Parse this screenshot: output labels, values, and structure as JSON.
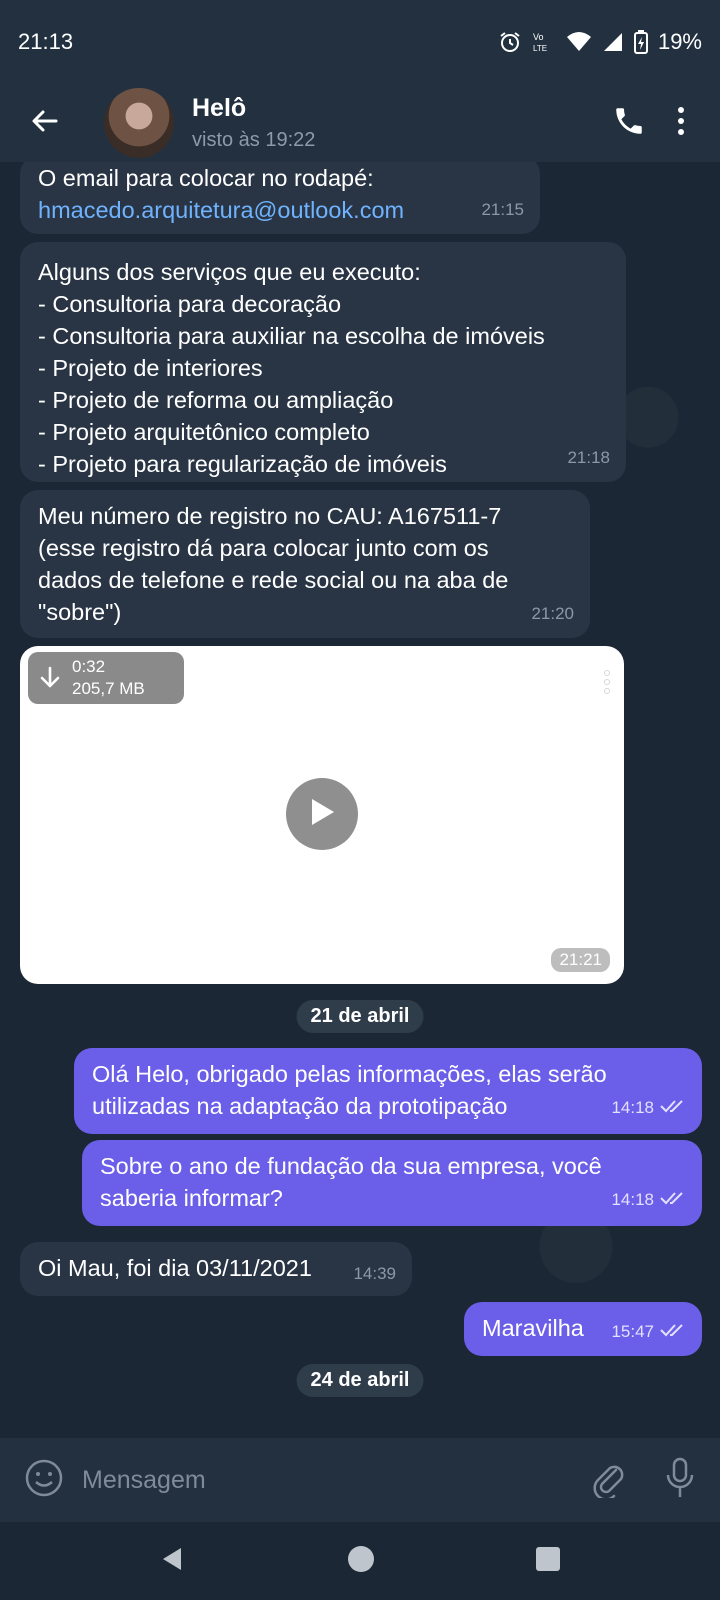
{
  "status_bar": {
    "time": "21:13",
    "battery": "19%",
    "icons": [
      "alarm-icon",
      "volte-icon",
      "wifi-icon",
      "signal-icon",
      "battery-icon"
    ]
  },
  "header": {
    "contact_name": "Helô",
    "last_seen": "visto às 19:22",
    "icons": [
      "back-arrow-icon",
      "phone-icon",
      "more-vert-icon"
    ]
  },
  "messages": [
    {
      "direction": "in",
      "lines": "O email para colocar no rodapé:",
      "link": "hmacedo.arquitetura@outlook.com",
      "time": "21:15"
    },
    {
      "direction": "in",
      "text": "Alguns dos serviços que eu executo:\n- Consultoria para decoração\n- Consultoria para auxiliar na escolha de imóveis\n- Projeto de interiores\n- Projeto de reforma ou ampliação\n- Projeto arquitetônico completo\n- Projeto para regularização de imóveis",
      "time": "21:18"
    },
    {
      "direction": "in",
      "text": "Meu número de registro no CAU: A167511-7\n(esse registro dá para colocar junto com os\ndados de telefone e rede social ou na aba de\n\"sobre\")",
      "time": "21:20"
    },
    {
      "direction": "in",
      "type": "video",
      "duration": "0:32",
      "size": "205,7 MB",
      "time": "21:21"
    },
    {
      "direction": "out",
      "text": "Olá Helo, obrigado pelas informações, elas serão\nutilizadas na adaptação da prototipação",
      "time": "14:18"
    },
    {
      "direction": "out",
      "text": "Sobre o ano de fundação da sua empresa, você\nsaberia informar?",
      "time": "14:18"
    },
    {
      "direction": "in",
      "text": "Oi Mau, foi dia 03/11/2021",
      "time": "14:39"
    },
    {
      "direction": "out",
      "text": "Maravilha",
      "time": "15:47"
    }
  ],
  "date_separators": [
    "21 de abril",
    "24 de abril"
  ],
  "composer": {
    "placeholder": "Mensagem",
    "icons": [
      "emoji-icon",
      "attach-icon",
      "mic-icon"
    ]
  },
  "colors": {
    "background": "#1b2734",
    "header": "#22303f",
    "incoming_bubble": "#293544",
    "outgoing_bubble": "#6b5ee8",
    "link": "#6fb3ff"
  }
}
